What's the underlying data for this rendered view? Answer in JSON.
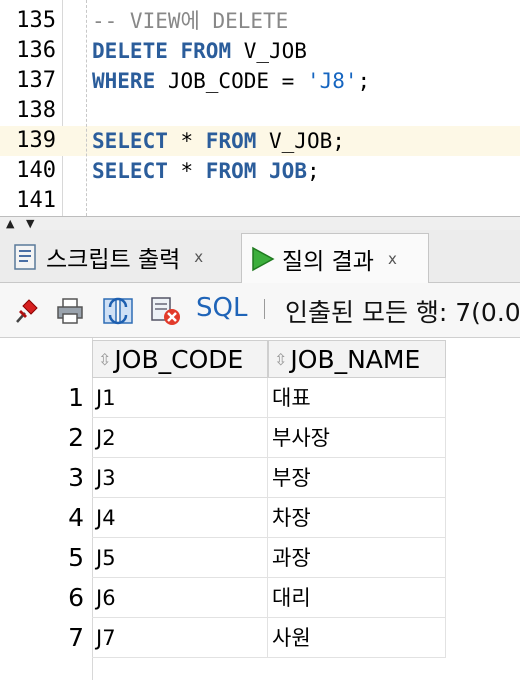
{
  "editor": {
    "lines": [
      {
        "num": "135",
        "tokens": [
          {
            "t": "-- VIEW에 DELETE",
            "k": "cm"
          }
        ]
      },
      {
        "num": "136",
        "tokens": [
          {
            "t": "DELETE",
            "k": "kw"
          },
          {
            "t": " ",
            "k": "tx"
          },
          {
            "t": "FROM",
            "k": "kw"
          },
          {
            "t": " V_JOB",
            "k": "tx"
          }
        ]
      },
      {
        "num": "137",
        "tokens": [
          {
            "t": "WHERE",
            "k": "kw"
          },
          {
            "t": " JOB_CODE = ",
            "k": "tx"
          },
          {
            "t": "'J8'",
            "k": "str"
          },
          {
            "t": ";",
            "k": "tx"
          }
        ]
      },
      {
        "num": "138",
        "tokens": []
      },
      {
        "num": "139",
        "current": true,
        "tokens": [
          {
            "t": "SELECT",
            "k": "kw"
          },
          {
            "t": " * ",
            "k": "tx"
          },
          {
            "t": "FROM",
            "k": "kw"
          },
          {
            "t": " V_JOB;",
            "k": "tx"
          }
        ]
      },
      {
        "num": "140",
        "tokens": [
          {
            "t": "SELECT",
            "k": "kw"
          },
          {
            "t": " * ",
            "k": "tx"
          },
          {
            "t": "FROM",
            "k": "kw"
          },
          {
            "t": " ",
            "k": "tx"
          },
          {
            "t": "JOB",
            "k": "kw"
          },
          {
            "t": ";",
            "k": "tx"
          }
        ]
      },
      {
        "num": "141",
        "tokens": []
      }
    ]
  },
  "tabs": {
    "script_output": {
      "label": "스크립트 출력",
      "close": "x"
    },
    "query_result": {
      "label": "질의 결과",
      "close": "x"
    }
  },
  "toolbar": {
    "pin_icon": "pin-icon",
    "print_icon": "print-icon",
    "refresh_icon": "refresh-icon",
    "cancel_icon": "cancel-fetch-icon",
    "sql_label": "SQL",
    "status": "인출된 모든 행: 7(0.0"
  },
  "grid": {
    "columns": [
      "JOB_CODE",
      "JOB_NAME"
    ],
    "rows": [
      {
        "n": "1",
        "code": "J1",
        "name": "대표"
      },
      {
        "n": "2",
        "code": "J2",
        "name": "부사장"
      },
      {
        "n": "3",
        "code": "J3",
        "name": "부장"
      },
      {
        "n": "4",
        "code": "J4",
        "name": "차장"
      },
      {
        "n": "5",
        "code": "J5",
        "name": "과장"
      },
      {
        "n": "6",
        "code": "J6",
        "name": "대리"
      },
      {
        "n": "7",
        "code": "J7",
        "name": "사원"
      }
    ]
  },
  "colors": {
    "keyword": "#2b5d9b",
    "string": "#1565c0",
    "comment": "#888888",
    "current_line": "#fdf8e6",
    "sql_link": "#1f64b8"
  }
}
